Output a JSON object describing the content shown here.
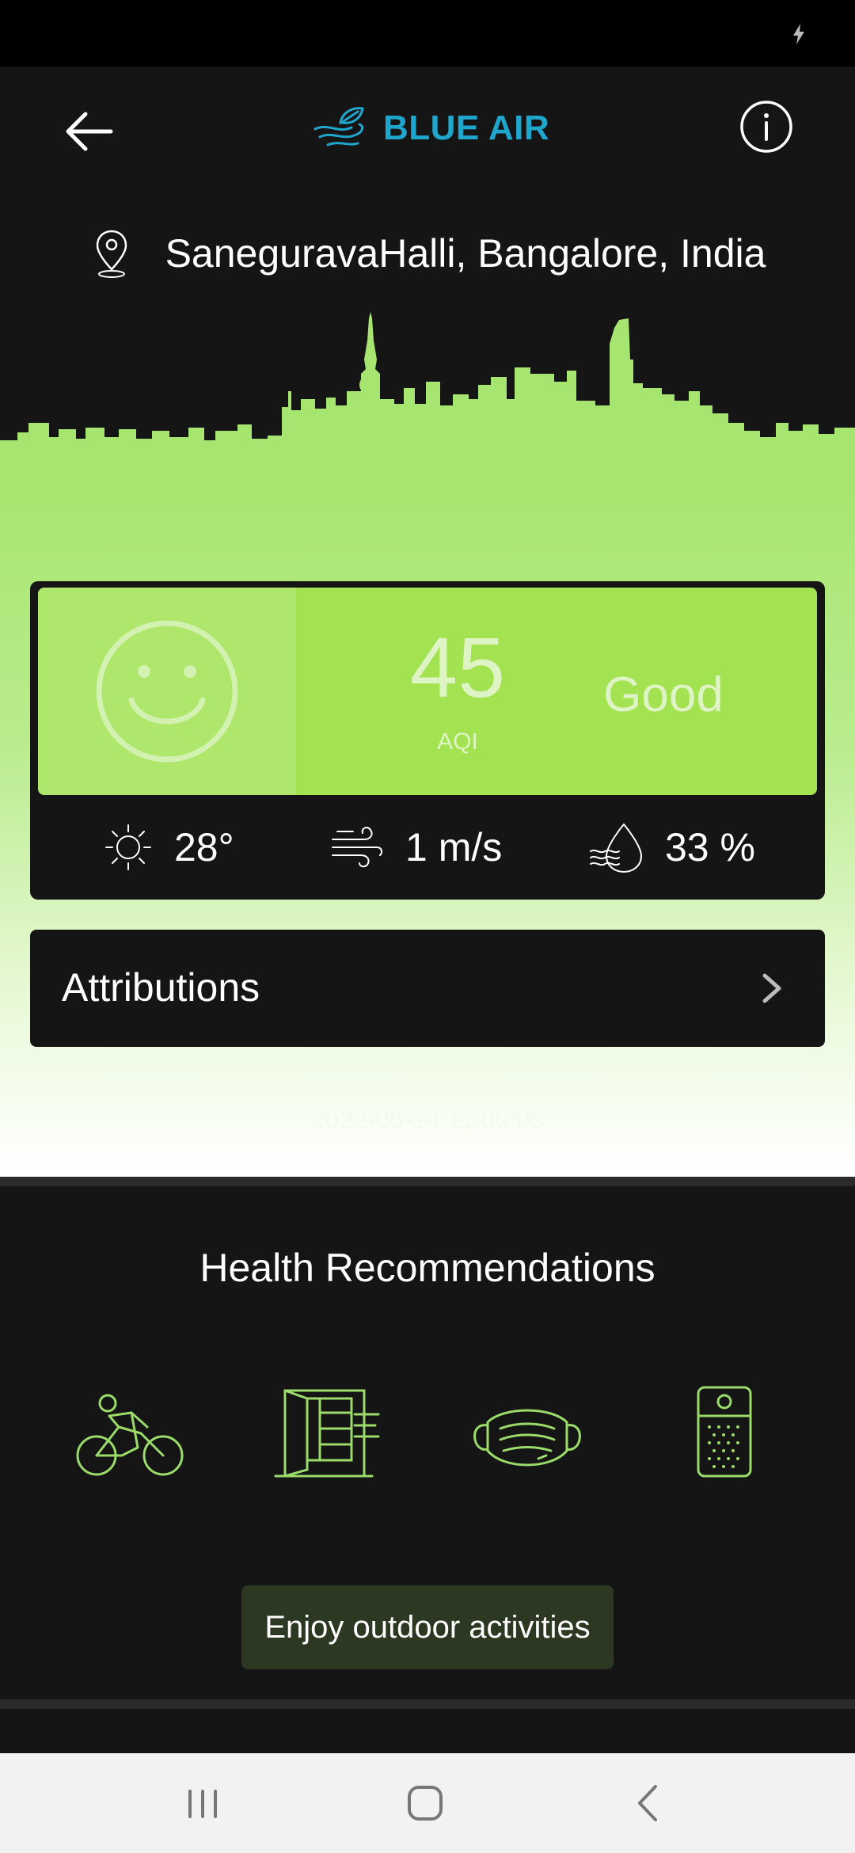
{
  "app": {
    "brand_name": "BLUE AIR"
  },
  "colors": {
    "brand": "#1fa6cd",
    "aqi_good": "#a3e250",
    "icon_green": "#9bdb6a"
  },
  "location": {
    "text": "SaneguravaHalli, Bangalore, India"
  },
  "aqi": {
    "value": "45",
    "label": "AQI",
    "status": "Good"
  },
  "weather": {
    "temperature": "28°",
    "wind": "1 m/s",
    "humidity": "33 %"
  },
  "attributions": {
    "label": "Attributions"
  },
  "timestamp": "2022-06-14 11:00:00",
  "health": {
    "title": "Health Recommendations",
    "icons": [
      "cycling-icon",
      "open-window-icon",
      "face-mask-icon",
      "air-purifier-icon"
    ],
    "message": "Enjoy outdoor activities"
  },
  "icons": {
    "back": "arrow-left-icon",
    "info": "info-icon",
    "location": "map-pin-icon",
    "temperature": "sun-icon",
    "wind": "wind-icon",
    "humidity": "humidity-icon",
    "chevron": "chevron-right-icon"
  }
}
